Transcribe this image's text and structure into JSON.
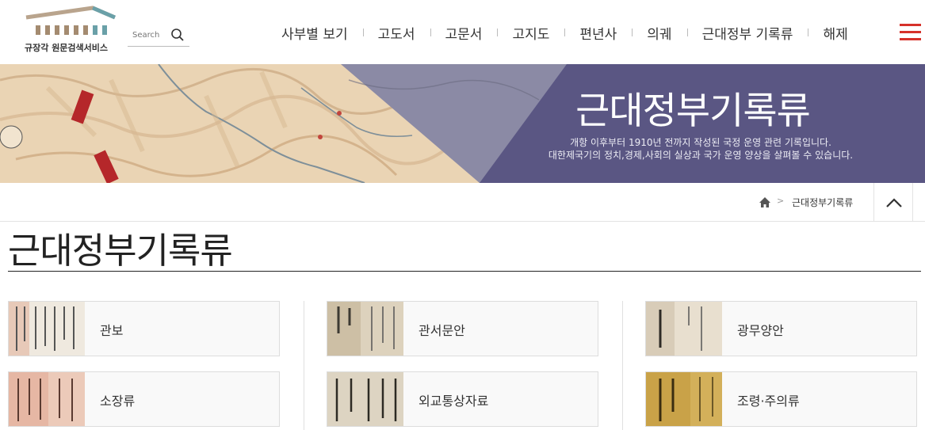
{
  "header": {
    "logo_name": "규장각 원문검색서비스",
    "search_placeholder": "Search",
    "nav": [
      "사부별 보기",
      "고도서",
      "고문서",
      "고지도",
      "편년사",
      "의궤",
      "근대정부 기록류",
      "해제"
    ]
  },
  "banner": {
    "title": "근대정부기록류",
    "desc_line1": "개항 이후부터 1910년 전까지 작성된 국정 운영 관련 기록입니다.",
    "desc_line2": "대한제국기의 정치,경제,사회의 실상과 국가 운영 양상을 살펴볼 수 있습니다."
  },
  "breadcrumb": {
    "separator": ">",
    "current": "근대정부기록류"
  },
  "page": {
    "title": "근대정부기록류"
  },
  "categories": [
    {
      "label": "관보"
    },
    {
      "label": "관서문안"
    },
    {
      "label": "광무양안"
    },
    {
      "label": "소장류"
    },
    {
      "label": "외교통상자료"
    },
    {
      "label": "조령·주의류"
    }
  ],
  "colors": {
    "accent_red": "#d6312a",
    "banner_purple": "#5a5683"
  }
}
